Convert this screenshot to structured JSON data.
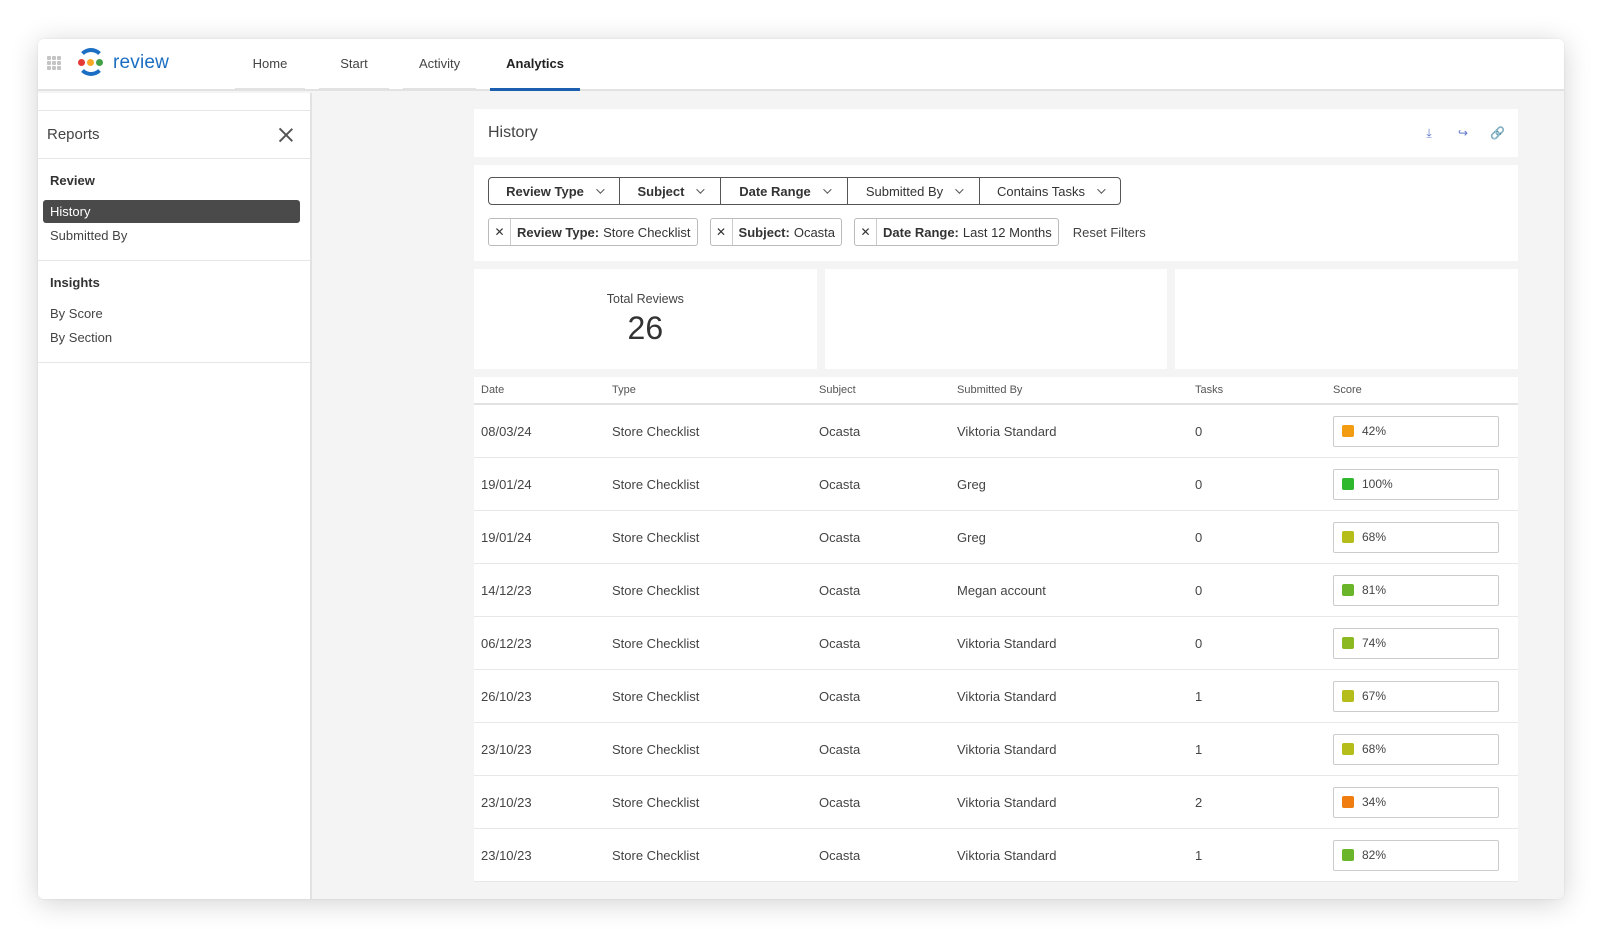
{
  "app": {
    "name": "review"
  },
  "nav": {
    "tabs": [
      {
        "label": "Home"
      },
      {
        "label": "Start"
      },
      {
        "label": "Activity"
      },
      {
        "label": "Analytics"
      }
    ]
  },
  "sidebar": {
    "title": "Reports",
    "sections": [
      {
        "heading": "Review",
        "items": [
          "History",
          "Submitted By"
        ]
      },
      {
        "heading": "Insights",
        "items": [
          "By Score",
          "By Section"
        ]
      }
    ]
  },
  "page": {
    "title": "History"
  },
  "filters": {
    "dropdowns": [
      "Review Type",
      "Subject",
      "Date Range",
      "Submitted By",
      "Contains Tasks"
    ],
    "chips": [
      {
        "key": "Review Type:",
        "value": "Store Checklist"
      },
      {
        "key": "Subject:",
        "value": "Ocasta"
      },
      {
        "key": "Date Range:",
        "value": "Last 12 Months"
      }
    ],
    "reset_label": "Reset Filters"
  },
  "stats": {
    "total_label": "Total Reviews",
    "total_value": "26"
  },
  "table": {
    "headers": [
      "Date",
      "Type",
      "Subject",
      "Submitted By",
      "Tasks",
      "Score"
    ],
    "rows": [
      {
        "date": "08/03/24",
        "type": "Store Checklist",
        "subject": "Ocasta",
        "submitted_by": "Viktoria Standard",
        "tasks": "0",
        "score": "42%",
        "color": "#f39c12"
      },
      {
        "date": "19/01/24",
        "type": "Store Checklist",
        "subject": "Ocasta",
        "submitted_by": "Greg",
        "tasks": "0",
        "score": "100%",
        "color": "#2eb82e"
      },
      {
        "date": "19/01/24",
        "type": "Store Checklist",
        "subject": "Ocasta",
        "submitted_by": "Greg",
        "tasks": "0",
        "score": "68%",
        "color": "#b5bd1a"
      },
      {
        "date": "14/12/23",
        "type": "Store Checklist",
        "subject": "Ocasta",
        "submitted_by": "Megan account",
        "tasks": "0",
        "score": "81%",
        "color": "#6ab52a"
      },
      {
        "date": "06/12/23",
        "type": "Store Checklist",
        "subject": "Ocasta",
        "submitted_by": "Viktoria Standard",
        "tasks": "0",
        "score": "74%",
        "color": "#8cb820"
      },
      {
        "date": "26/10/23",
        "type": "Store Checklist",
        "subject": "Ocasta",
        "submitted_by": "Viktoria Standard",
        "tasks": "1",
        "score": "67%",
        "color": "#b5bd1a"
      },
      {
        "date": "23/10/23",
        "type": "Store Checklist",
        "subject": "Ocasta",
        "submitted_by": "Viktoria Standard",
        "tasks": "1",
        "score": "68%",
        "color": "#b5bd1a"
      },
      {
        "date": "23/10/23",
        "type": "Store Checklist",
        "subject": "Ocasta",
        "submitted_by": "Viktoria Standard",
        "tasks": "2",
        "score": "34%",
        "color": "#f07d10"
      },
      {
        "date": "23/10/23",
        "type": "Store Checklist",
        "subject": "Ocasta",
        "submitted_by": "Viktoria Standard",
        "tasks": "1",
        "score": "82%",
        "color": "#6ab52a"
      }
    ]
  },
  "colors": {
    "brand": "#1b6ec2",
    "active_tab": "#1b5fae",
    "sidebar_active": "#4a4a4a"
  },
  "icons": {
    "download": "download-icon",
    "share": "share-icon",
    "link": "link-icon",
    "apps": "apps-grid-icon",
    "close": "close-icon"
  }
}
